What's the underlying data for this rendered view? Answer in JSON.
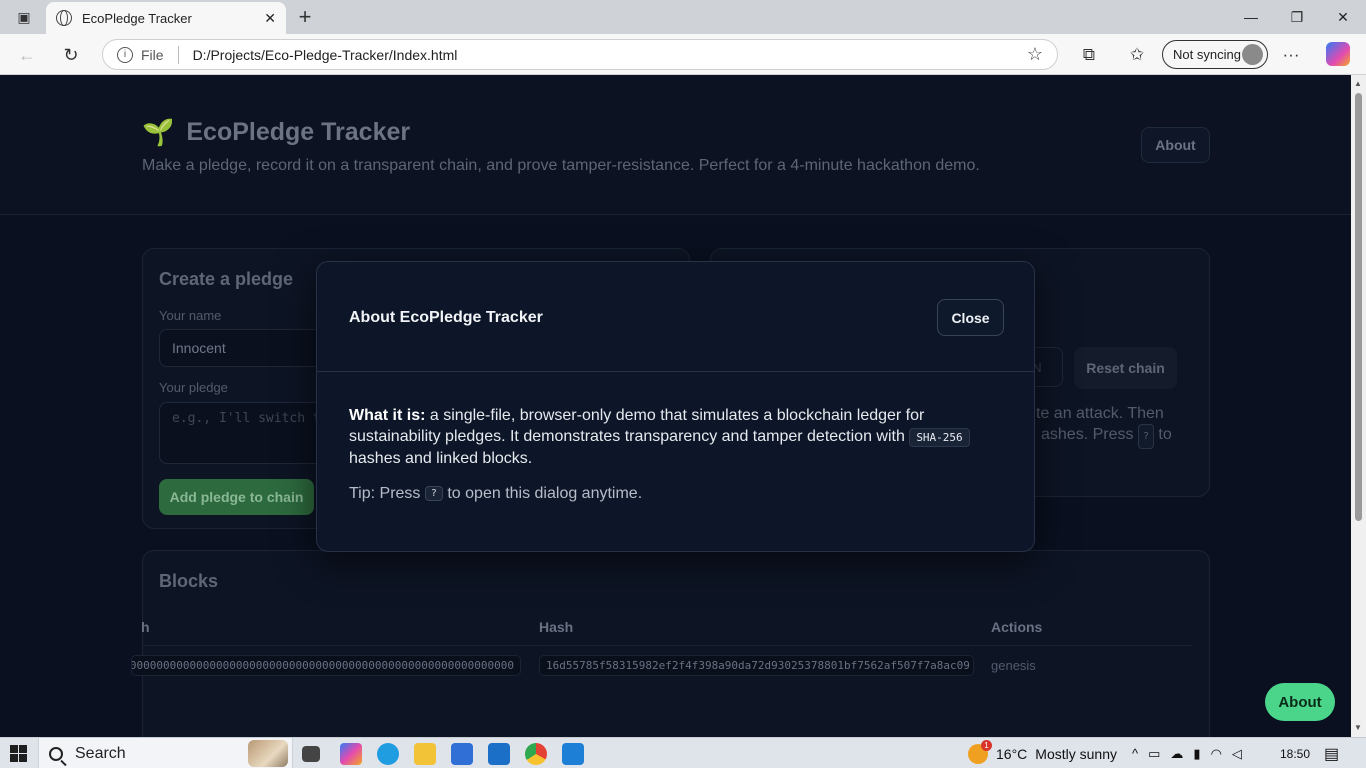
{
  "browser": {
    "tab_title": "EcoPledge Tracker",
    "url_scheme_label": "File",
    "url_path": "D:/Projects/Eco-Pledge-Tracker/Index.html",
    "sync_label": "Not syncing"
  },
  "header": {
    "logo_emoji": "🌱",
    "title": "EcoPledge Tracker",
    "tagline": "Make a pledge, record it on a transparent chain, and prove tamper-resistance. Perfect for a 4-minute hackathon demo.",
    "about_label": "About"
  },
  "create_card": {
    "title": "Create a pledge",
    "name_label": "Your name",
    "name_value": "Innocent",
    "pledge_label": "Your pledge",
    "pledge_placeholder": "e.g., I'll switch to",
    "add_button": "Add pledge to chain"
  },
  "right_card": {
    "partial_button": "N",
    "reset_button": "Reset chain",
    "text_line1": "te an attack. Then",
    "text_line2_a": "ashes. Press",
    "key": "?",
    "text_line2_b": "to"
  },
  "blocks": {
    "title": "Blocks",
    "columns": {
      "prev": "h",
      "hash": "Hash",
      "actions": "Actions"
    },
    "rows": [
      {
        "prev_hash": "0000000000000000000000000000000000000000000000000000000000000000",
        "hash": "16d55785f58315982ef2f4f398a90da72d93025378801bf7562af507f7a8ac09",
        "action": "genesis"
      }
    ]
  },
  "fab": {
    "about_label": "About"
  },
  "modal": {
    "title": "About EcoPledge Tracker",
    "close_label": "Close",
    "what_label": "What it is:",
    "body_a": "a single-file, browser-only demo that simulates a blockchain ledger for sustainability pledges. It demonstrates transparency and tamper detection with",
    "code": "SHA-256",
    "body_b": "hashes and linked blocks.",
    "tip_a": "Tip: Press",
    "tip_key": "?",
    "tip_b": "to open this dialog anytime."
  },
  "taskbar": {
    "search_label": "Search",
    "weather_badge": "1",
    "temperature": "16°C",
    "weather": "Mostly sunny",
    "time": "18:50"
  },
  "colors": {
    "page_bg": "#0a1020",
    "accent_green": "#4ad58b",
    "modal_bg": "#0d1628"
  }
}
